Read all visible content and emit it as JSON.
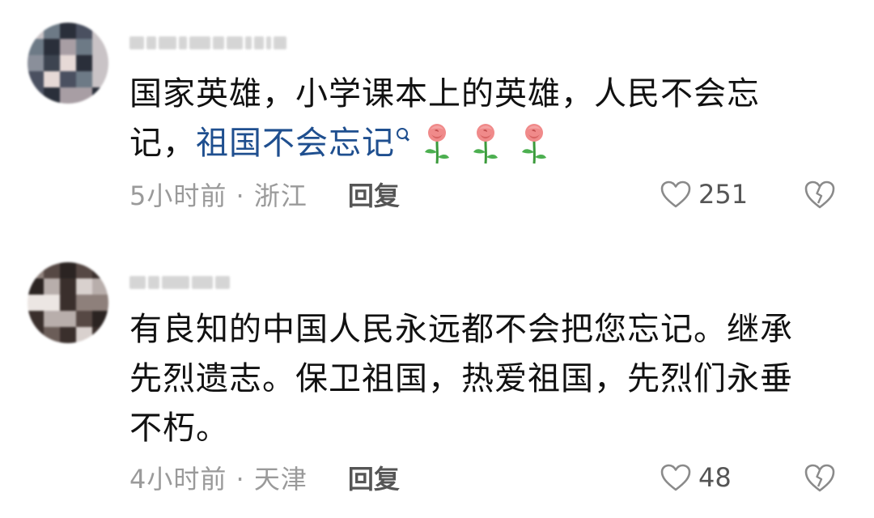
{
  "comments": [
    {
      "text_lines": [
        "国家英雄，小学课本上的英雄，人民不会忘",
        "记，"
      ],
      "hashtag": "祖国不会忘记",
      "emoji": "🌹🌹🌹",
      "time": "5小时前",
      "location": "浙江",
      "reply_label": "回复",
      "likes": "251",
      "icons": {
        "like": "heart-outline-icon",
        "dislike": "broken-heart-icon",
        "hashtag": "search-icon",
        "emoji": "rose-icon"
      }
    },
    {
      "text_lines": [
        "有良知的中国人民永远都不会把您忘记。继承",
        "先烈遗志。保卫祖国，热爱祖国，先烈们永垂",
        "不朽。"
      ],
      "time": "4小时前",
      "location": "天津",
      "reply_label": "回复",
      "likes": "48",
      "icons": {
        "like": "heart-outline-icon",
        "dislike": "broken-heart-icon"
      }
    }
  ],
  "separator": "·",
  "colors": {
    "hashtag": "#1f4f8f",
    "meta": "#9a9a9a",
    "body": "#111111",
    "action": "#555555"
  }
}
